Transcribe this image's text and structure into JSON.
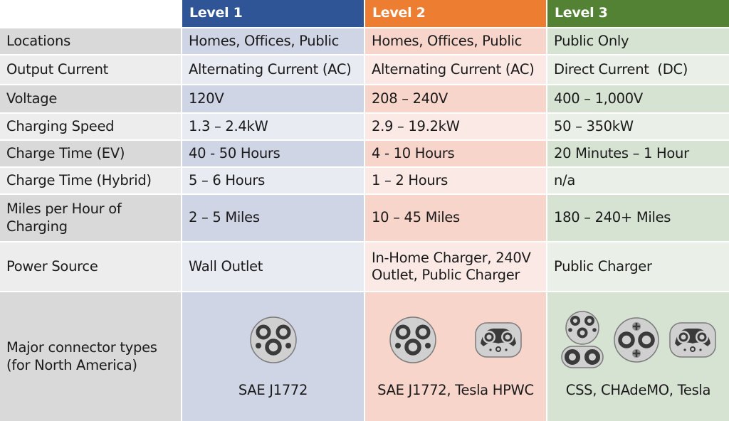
{
  "header": {
    "corner": "",
    "levels": [
      "Level 1",
      "Level 2",
      "Level 3"
    ]
  },
  "colors": {
    "level1": "#2f5597",
    "level2": "#ed7d31",
    "level3": "#548235"
  },
  "rows": [
    {
      "label": "Locations",
      "values": [
        "Homes, Offices, Public",
        "Homes, Offices, Public",
        "Public Only"
      ]
    },
    {
      "label": "Output Current",
      "values": [
        "Alternating Current (AC)",
        "Alternating Current (AC)",
        "Direct Current  (DC)"
      ]
    },
    {
      "label": "Voltage",
      "values": [
        "120V",
        "208 – 240V",
        "400 – 1,000V"
      ]
    },
    {
      "label": "Charging Speed",
      "values": [
        "1.3 – 2.4kW",
        "2.9 – 19.2kW",
        "50 – 350kW"
      ]
    },
    {
      "label": "Charge Time (EV)",
      "values": [
        "40 - 50 Hours",
        "4 - 10 Hours",
        "20 Minutes – 1 Hour"
      ]
    },
    {
      "label": "Charge Time (Hybrid)",
      "values": [
        "5 – 6 Hours",
        "1 – 2 Hours",
        "n/a"
      ]
    },
    {
      "label": "Miles per Hour of Charging",
      "values": [
        "2 – 5 Miles",
        "10 – 45 Miles",
        "180 – 240+ Miles"
      ]
    },
    {
      "label": "Power Source",
      "values": [
        "Wall Outlet",
        "In-Home Charger, 240V Outlet, Public Charger",
        "Public Charger"
      ]
    }
  ],
  "connectors": {
    "label": "Major connector types (for North America)",
    "level1": {
      "caption": "SAE J1772",
      "icons": [
        "sae-j1772-connector-icon"
      ]
    },
    "level2": {
      "caption": "SAE J1772, Tesla HPWC",
      "icons": [
        "sae-j1772-connector-icon",
        "tesla-hpwc-connector-icon"
      ]
    },
    "level3": {
      "caption": "CSS, CHAdeMO, Tesla",
      "icons": [
        "ccs-connector-icon",
        "chademo-connector-icon",
        "tesla-connector-icon"
      ]
    }
  }
}
